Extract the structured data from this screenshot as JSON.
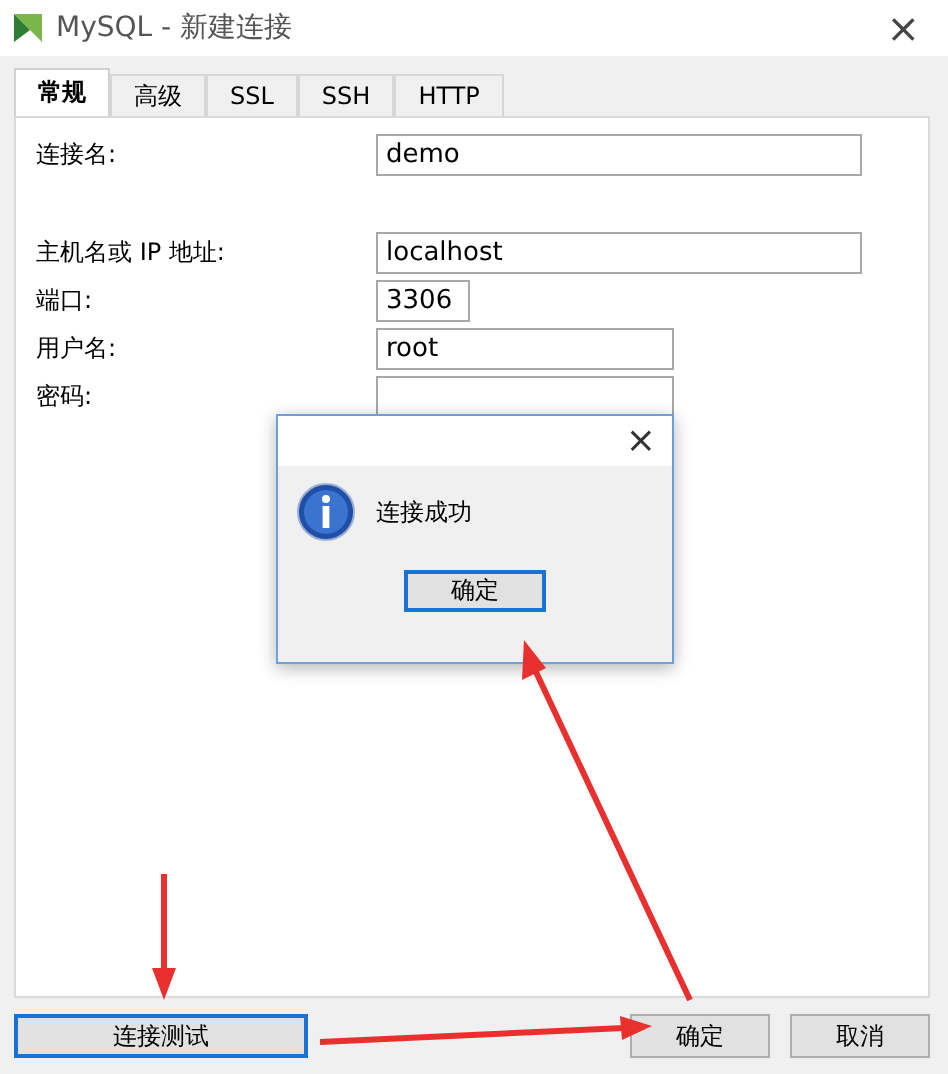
{
  "window": {
    "title": "MySQL - 新建连接",
    "close": "×"
  },
  "tabs": [
    {
      "label": "常规",
      "selected": true
    },
    {
      "label": "高级",
      "selected": false
    },
    {
      "label": "SSL",
      "selected": false
    },
    {
      "label": "SSH",
      "selected": false
    },
    {
      "label": "HTTP",
      "selected": false
    }
  ],
  "fields": [
    {
      "label": "连接名:",
      "value": "demo"
    },
    {
      "label": "主机名或 IP 地址:",
      "value": "localhost"
    },
    {
      "label": "端口:",
      "value": "3306"
    },
    {
      "label": "用户名:",
      "value": "root"
    },
    {
      "label": "密码:"
    }
  ],
  "dialog": {
    "close": "×",
    "message": "连接成功",
    "button": {
      "label": "确定",
      "focused": true
    }
  },
  "buttons": [
    {
      "label": "连接测试",
      "focused": true
    },
    {
      "label": "确定",
      "focused": false
    },
    {
      "label": "取消",
      "focused": false
    }
  ],
  "annotations": [
    {
      "kind": "arrow"
    },
    {
      "kind": "arrow"
    },
    {
      "kind": "arrow"
    }
  ]
}
